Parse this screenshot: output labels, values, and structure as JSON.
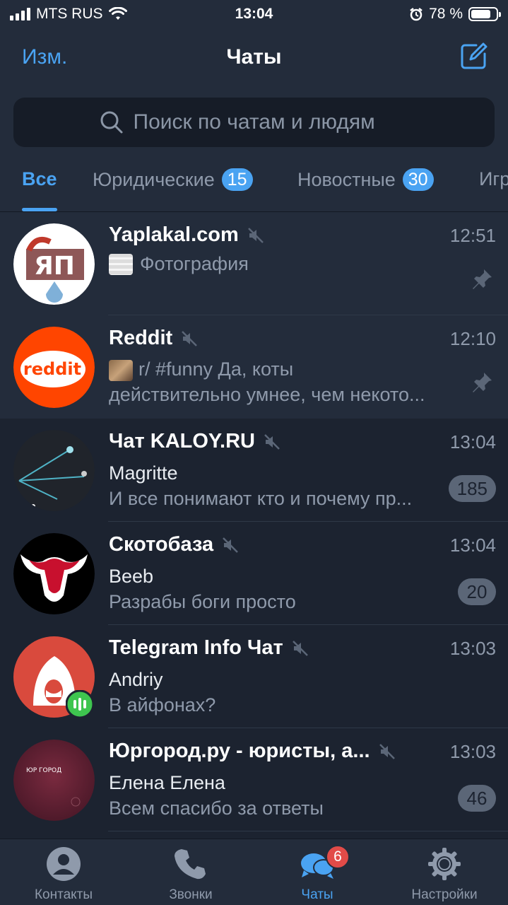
{
  "status_bar": {
    "carrier": "MTS RUS",
    "time": "13:04",
    "battery": "78 %",
    "battery_level": 0.78
  },
  "header": {
    "edit_label": "Изм.",
    "title": "Чаты"
  },
  "search": {
    "placeholder": "Поиск по чатам и людям"
  },
  "filter_tabs": [
    {
      "label": "Все",
      "badge": ""
    },
    {
      "label": "Юридические",
      "badge": "15"
    },
    {
      "label": "Новостные",
      "badge": "30"
    },
    {
      "label": "Игр",
      "badge": ""
    }
  ],
  "chats": [
    {
      "name": "Yaplakal.com",
      "time": "12:51",
      "preview": "Фотография",
      "muted": true,
      "pinned": true
    },
    {
      "name": "Reddit",
      "time": "12:10",
      "preview_line1": "r/ #funny Да, коты",
      "preview_line2": "действительно умнее, чем некото...",
      "muted": true,
      "pinned": true
    },
    {
      "name": "Чат KALOY.RU",
      "time": "13:04",
      "sender": "Magritte",
      "message": "И все понимают кто и почему пр...",
      "unread": "185",
      "muted": true
    },
    {
      "name": "Скотобаза",
      "time": "13:04",
      "sender": "Beeb",
      "message": "Разрабы боги просто",
      "unread": "20",
      "muted": true
    },
    {
      "name": "Telegram Info Чат",
      "time": "13:03",
      "sender": "Andriy",
      "message": "В айфонах?",
      "unread": "",
      "muted": true
    },
    {
      "name": "Юргород.ру - юристы, а...",
      "time": "13:03",
      "sender": "Елена Елена",
      "message": "Всем спасибо за ответы",
      "unread": "46",
      "muted": true
    }
  ],
  "avatar_labels": {
    "yaplakal": "ЯП",
    "reddit": "reddit",
    "urgorod": "ЮР ГОРОД"
  },
  "tab_bar": {
    "contacts": "Контакты",
    "calls": "Звонки",
    "chats": "Чаты",
    "chats_badge": "6",
    "settings": "Настройки"
  },
  "colors": {
    "accent": "#4aa3f2",
    "background": "#1c2330",
    "header": "#232c3b",
    "badge_red": "#e24b48"
  }
}
